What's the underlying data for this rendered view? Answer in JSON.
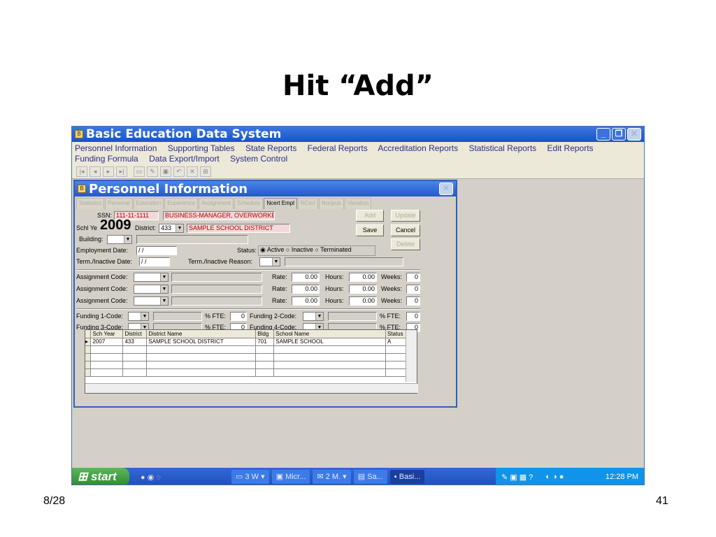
{
  "slide": {
    "title": "Hit “Add”",
    "date": "8/28",
    "page_number": "41"
  },
  "app": {
    "title": "Basic Education Data System",
    "menu": [
      "Personnel Information",
      "Supporting Tables",
      "State Reports",
      "Federal Reports",
      "Accreditation Reports",
      "Statistical Reports",
      "Edit Reports",
      "Funding Formula",
      "Data Export/Import",
      "System Control"
    ]
  },
  "form": {
    "title": "Personnel Information",
    "tabs": [
      "Statistics",
      "Personal",
      "Education",
      "Experience",
      "Assignment",
      "Schedule",
      "Ncert Empl",
      "NCert",
      "Nonpub",
      "Vacation"
    ],
    "active_tab": "Ncert Empl",
    "ssn_label": "SSN:",
    "ssn": "111-11-1111",
    "employee_name": "BUSINESS-MANAGER, OVERWORKED",
    "schl_year_label": "Schl Ye",
    "schl_year_overlay": "2009",
    "district_label": "District:",
    "district_code": "433",
    "district_name": "SAMPLE SCHOOL DISTRICT",
    "building_label": "Building:",
    "employment_date_label": "Employment Date:",
    "employment_date": "/ /",
    "status_label": "Status:",
    "status_options": [
      "Active",
      "Inactive",
      "Terminated"
    ],
    "status_selected": "Active",
    "term_date_label": "Term./Inactive Date:",
    "term_date": "/ /",
    "term_reason_label": "Term./Inactive Reason:",
    "buttons": {
      "add": "Add",
      "update": "Update",
      "save": "Save",
      "cancel": "Cancel",
      "delete": "Delete"
    },
    "assignments": [
      {
        "label": "Assignment Code:",
        "rate_label": "Rate:",
        "rate": "0.00",
        "hours_label": "Hours:",
        "hours": "0.00",
        "weeks_label": "Weeks:",
        "weeks": "0"
      },
      {
        "label": "Assignment Code:",
        "rate_label": "Rate:",
        "rate": "0.00",
        "hours_label": "Hours:",
        "hours": "0.00",
        "weeks_label": "Weeks:",
        "weeks": "0"
      },
      {
        "label": "Assignment Code:",
        "rate_label": "Rate:",
        "rate": "0.00",
        "hours_label": "Hours:",
        "hours": "0.00",
        "weeks_label": "Weeks:",
        "weeks": "0"
      }
    ],
    "funding": [
      {
        "label": "Funding 1-Code:",
        "fte_label": "% FTE:",
        "fte": "0"
      },
      {
        "label": "Funding 2-Code:",
        "fte_label": "% FTE:",
        "fte": "0"
      },
      {
        "label": "Funding 3-Code:",
        "fte_label": "% FTE:",
        "fte": "0"
      },
      {
        "label": "Funding 4-Code:",
        "fte_label": "% FTE:",
        "fte": "0"
      }
    ],
    "grid": {
      "headers": [
        "Sch Year",
        "District",
        "District Name",
        "Bldg",
        "School Name",
        "Status"
      ],
      "rows": [
        [
          "2007",
          "433",
          "SAMPLE SCHOOL DISTRICT",
          "701",
          "SAMPLE SCHOOL",
          "A"
        ]
      ]
    }
  },
  "taskbar": {
    "start": "start",
    "tasks": [
      "3 W",
      "Micr...",
      "2 M.",
      "Sa...",
      "Basi..."
    ],
    "active_task": "Basi...",
    "clock": "12:28 PM"
  }
}
